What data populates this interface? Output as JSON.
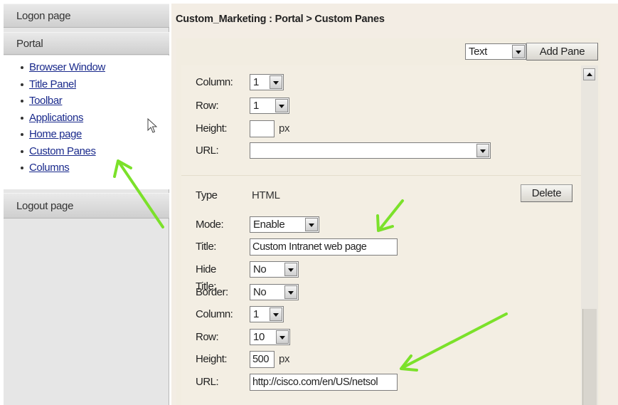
{
  "sidebar": {
    "logon": "Logon page",
    "portal": "Portal",
    "items": [
      {
        "label": "Browser Window"
      },
      {
        "label": "Title Panel"
      },
      {
        "label": "Toolbar"
      },
      {
        "label": "Applications"
      },
      {
        "label": "Home page"
      },
      {
        "label": "Custom Panes"
      },
      {
        "label": "Columns"
      }
    ],
    "logout": "Logout page"
  },
  "main": {
    "breadcrumb": "Custom_Marketing : Portal > Custom Panes",
    "type_select": "Text",
    "add_pane": "Add Pane",
    "pane1": {
      "column_label": "Column:",
      "column_value": "1",
      "row_label": "Row:",
      "row_value": "1",
      "height_label": "Height:",
      "height_value": "",
      "height_unit": "px",
      "url_label": "URL:",
      "url_value": ""
    },
    "pane2": {
      "type_label": "Type",
      "type_value": "HTML",
      "delete": "Delete",
      "mode_label": "Mode:",
      "mode_value": "Enable",
      "title_label": "Title:",
      "title_value": "Custom Intranet web page",
      "hide_title_label": "Hide Title:",
      "hide_title_value": "No",
      "border_label": "Border:",
      "border_value": "No",
      "column_label": "Column:",
      "column_value": "1",
      "row_label": "Row:",
      "row_value": "10",
      "height_label": "Height:",
      "height_value": "500",
      "height_unit": "px",
      "url_label": "URL:",
      "url_value": "http://cisco.com/en/US/netsol"
    }
  },
  "colors": {
    "annotation_arrow": "#7be12a",
    "link": "#1a2a8c"
  },
  "icons": [
    "mouse-cursor-icon",
    "annotation-arrow-icon",
    "dropdown-arrow-icon",
    "scroll-up-icon"
  ]
}
